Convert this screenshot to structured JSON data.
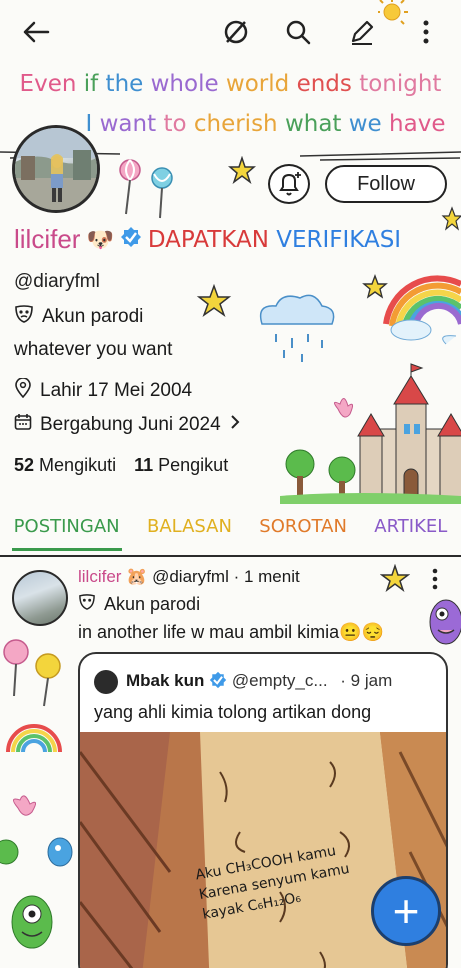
{
  "topbar": {
    "back_icon": "arrow-left-icon",
    "mute_icon": "slashed-circle-icon",
    "search_icon": "search-icon",
    "edit_icon": "pencil-icon",
    "more_icon": "more-vertical-icon"
  },
  "banner": {
    "line1": [
      {
        "text": "Even",
        "color": "#e05a8a"
      },
      {
        "text": "if",
        "color": "#4aa05a"
      },
      {
        "text": "the",
        "color": "#3f8fd0"
      },
      {
        "text": "whole",
        "color": "#9a6ad0"
      },
      {
        "text": "world",
        "color": "#e8a53a"
      },
      {
        "text": "ends",
        "color": "#e05050"
      },
      {
        "text": "tonight",
        "color": "#e07aa0"
      }
    ],
    "line2": [
      {
        "text": "I",
        "color": "#3f8fd0"
      },
      {
        "text": "want",
        "color": "#9a6ad0"
      },
      {
        "text": "to",
        "color": "#e07aa0"
      },
      {
        "text": "cherish",
        "color": "#e8a53a"
      },
      {
        "text": "what",
        "color": "#4aa05a"
      },
      {
        "text": "we",
        "color": "#3f8fd0"
      },
      {
        "text": "have",
        "color": "#e05a8a"
      }
    ]
  },
  "profile": {
    "display_name": "lilcifer",
    "emoji": "🐶",
    "get_verified": "DAPATKAN VERIFIKASI",
    "handle": "@diaryfml",
    "parody_label": "Akun parodi",
    "bio": "whatever you want",
    "birthday": "Lahir 17 Mei 2004",
    "joined": "Bergabung Juni 2024",
    "following_count": "52",
    "following_label": "Mengikuti",
    "followers_count": "11",
    "followers_label": "Pengikut",
    "follow_button": "Follow"
  },
  "tabs": [
    {
      "label": "POSTINGAN",
      "color": "#3a9a4c",
      "active": true
    },
    {
      "label": "BALASAN",
      "color": "#e0b020",
      "active": false
    },
    {
      "label": "SOROTAN",
      "color": "#e07a2a",
      "active": false
    },
    {
      "label": "ARTIKEL",
      "color": "#8a5ac8",
      "active": false
    }
  ],
  "post": {
    "name": "lilcifer",
    "emoji": "🐹",
    "handle_time": "@diaryfml · 1 menit",
    "parody_label": "Akun parodi",
    "text": "in another life w mau ambil kimia😐😔",
    "quote": {
      "name": "Mbak kun",
      "handle": "@empty_c...",
      "time": "· 9 jam",
      "text": "yang ahli kimia tolong artikan dong",
      "image_text_line1": "Aku CH₃COOH kamu",
      "image_text_line2": "Karena senyum kamu",
      "image_text_line3": "kayak C₆H₁₂O₆"
    }
  },
  "fab": {
    "label": "+"
  },
  "colors": {
    "accent_blue": "#2f7fe0",
    "verified_blue": "#3f9ae8",
    "get_verified_red": "#d83a3a",
    "get_verified_blue": "#2f7fe0"
  }
}
